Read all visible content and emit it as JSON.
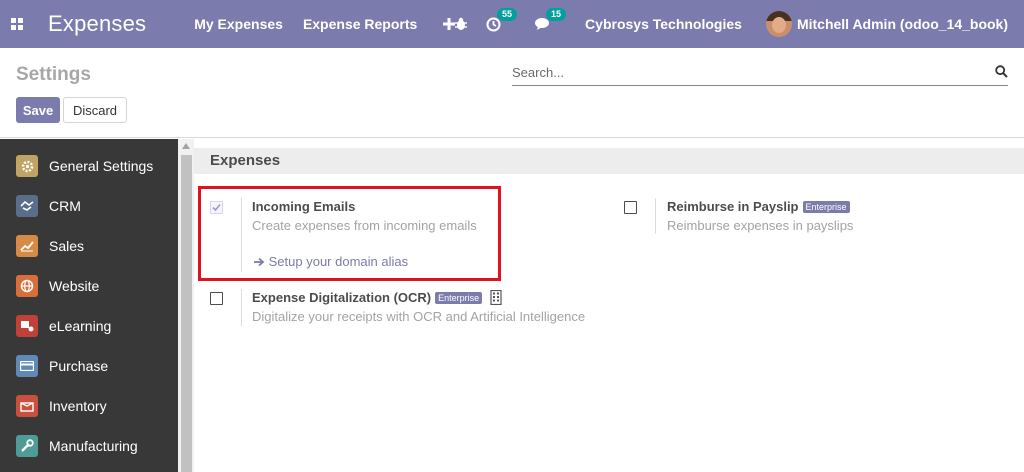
{
  "navbar": {
    "app_title": "Expenses",
    "menu": [
      "My Expenses",
      "Expense Reports"
    ],
    "activity_count": "55",
    "message_count": "15",
    "company": "Cybrosys Technologies",
    "user": "Mitchell Admin (odoo_14_book)",
    "colors": {
      "bar": "#7c7bad",
      "badge": "#00a09d"
    }
  },
  "control": {
    "title": "Settings",
    "save_label": "Save",
    "discard_label": "Discard",
    "search_placeholder": "Search..."
  },
  "sidebar": {
    "items": [
      {
        "label": "General Settings",
        "icon": "gear-icon",
        "color": "#c0a465"
      },
      {
        "label": "CRM",
        "icon": "handshake-icon",
        "color": "#5a6e8c"
      },
      {
        "label": "Sales",
        "icon": "chart-up-icon",
        "color": "#d58a45"
      },
      {
        "label": "Website",
        "icon": "globe-icon",
        "color": "#d86f3a"
      },
      {
        "label": "eLearning",
        "icon": "elearning-icon",
        "color": "#c0403a"
      },
      {
        "label": "Purchase",
        "icon": "credit-card-icon",
        "color": "#5f8ab8"
      },
      {
        "label": "Inventory",
        "icon": "box-icon",
        "color": "#c8503f"
      },
      {
        "label": "Manufacturing",
        "icon": "wrench-icon",
        "color": "#4f9b95"
      }
    ]
  },
  "section": {
    "title": "Expenses",
    "settings": {
      "incoming": {
        "title": "Incoming Emails",
        "description": "Create expenses from incoming emails",
        "link": "Setup your domain alias",
        "checked": true
      },
      "reimburse": {
        "title": "Reimburse in Payslip",
        "badge": "Enterprise",
        "description": "Reimburse expenses in payslips",
        "checked": false
      },
      "ocr": {
        "title": "Expense Digitalization (OCR)",
        "badge": "Enterprise",
        "description": "Digitalize your receipts with OCR and Artificial Intelligence",
        "checked": false
      }
    }
  }
}
